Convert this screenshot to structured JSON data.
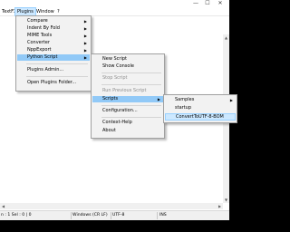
{
  "window": {
    "minimize": "—",
    "maximize": "☐",
    "close": "✕"
  },
  "menubar": [
    "TextFX",
    "Plugins",
    "Window",
    "?"
  ],
  "plugins_menu": {
    "items": [
      "Compare",
      "Indent By Fold",
      "MIME Tools",
      "Converter",
      "NppExport",
      "Python Script",
      "Plugins Admin...",
      "Open Plugins Folder..."
    ]
  },
  "python_menu": {
    "items": [
      "New Script",
      "Show Console",
      "Stop Script",
      "Run Previous Script",
      "Scripts",
      "Configuration...",
      "Context-Help",
      "About"
    ]
  },
  "scripts_menu": {
    "items": [
      "Samples",
      "startup",
      "ConvertToUTF-8-BOM"
    ]
  },
  "status": {
    "position": "n : 1   Sel : 0 | 0",
    "eol": "Windows (CR LF)",
    "encoding": "UTF-8",
    "mode": "INS"
  },
  "icons": {
    "submenu_arrow": "chevron-right-icon",
    "scroll_up": "chevron-up-icon",
    "scroll_down": "chevron-down-icon",
    "scroll_left": "chevron-left-icon",
    "scroll_right": "chevron-right-icon"
  },
  "colors": {
    "highlight": "#91c9f7",
    "selected": "#cce8ff",
    "menu_bg": "#f2f2f2",
    "disabled_text": "#8d8d8d",
    "background": "#000000"
  }
}
